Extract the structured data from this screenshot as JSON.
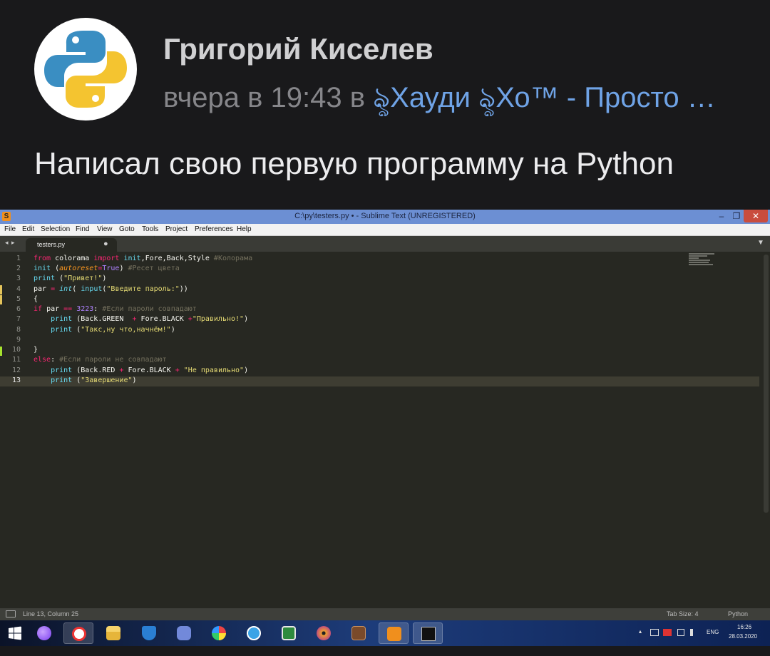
{
  "post": {
    "author": "Григорий Киселев",
    "time_prefix": "вчера в 19:43 в ",
    "group": "ৡХауди ৡХо™ - Просто …",
    "text": "Написал свою первую программу на Python"
  },
  "window": {
    "title": "C:\\py\\testers.py • - Sublime Text (UNREGISTERED)",
    "logo_letter": "S",
    "min_glyph": "–",
    "max_glyph": "❐",
    "close_glyph": "✕"
  },
  "menu": [
    "File",
    "Edit",
    "Selection",
    "Find",
    "View",
    "Goto",
    "Tools",
    "Project",
    "Preferences",
    "Help"
  ],
  "tabs": {
    "nav": "◂ ▸",
    "active_file": "testers.py",
    "dirty_glyph": "●",
    "dropdown_glyph": "▼"
  },
  "editor": {
    "line_numbers": [
      "1",
      "2",
      "3",
      "4",
      "5",
      "6",
      "7",
      "8",
      "9",
      "10",
      "11",
      "12",
      "13"
    ],
    "code": [
      "from colorama import init,Fore,Back,Style #Колорама",
      "init (autoreset=True) #Ресет цвета",
      "print (\"Привет!\")",
      "par = int( input(\"Введите пароль:\"))",
      "{",
      "if par == 3223: #Если пароли совпадают",
      "    print (Back.GREEN  + Fore.BLACK +\"Правильно!\")",
      "    print (\"Такс,ну что,начнём!\")",
      "",
      "}",
      "else: #Если пароли не совпадают",
      "    print (Back.RED + Fore.BLACK + \"Не правильно\")",
      "    print (\"Завершение\")"
    ],
    "modified_lines": [
      4,
      5,
      10
    ]
  },
  "status": {
    "position": "Line 13, Column 25",
    "tab_size": "Tab Size: 4",
    "syntax": "Python"
  },
  "taskbar": {
    "lang": "ENG",
    "time": "16:26",
    "date": "28.03.2020",
    "tray_up": "▴",
    "apps": [
      "windows-start",
      "alice-voice-assistant",
      "yandex-browser",
      "file-explorer",
      "windows-defender",
      "discord",
      "paint",
      "utorrent",
      "app-green",
      "media-player",
      "game-character",
      "sublime-text",
      "command-prompt"
    ]
  },
  "colors": {
    "accent_link": "#6fa3e6",
    "editor_bg": "#272822",
    "titlebar": "#6c8fd3",
    "keyword": "#f92672",
    "function": "#66d9ef",
    "string": "#e6db74",
    "number": "#ae81ff",
    "comment": "#75715e"
  }
}
